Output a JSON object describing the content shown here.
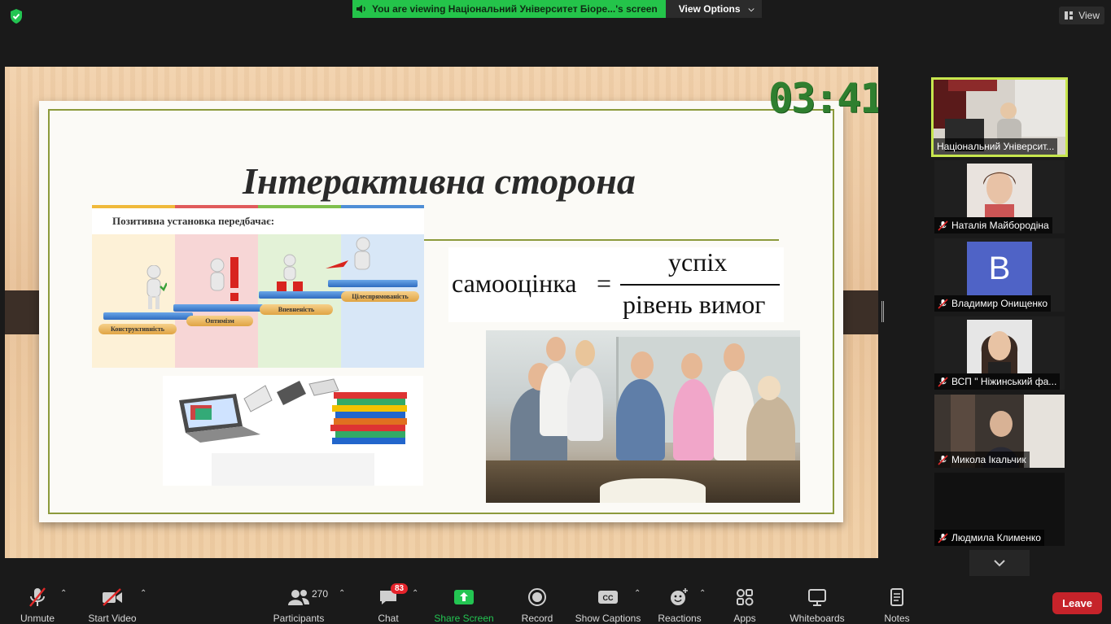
{
  "top": {
    "viewing_text": "You are viewing Національний Університет Біоре...'s screen",
    "view_options": "View Options",
    "view": "View"
  },
  "shared": {
    "timer": "03:41",
    "slide_title": "Інтерактивна сторона",
    "positive": {
      "heading": "Позитивна установка передбачає:",
      "steps": [
        "Конструктивність",
        "Оптимізм",
        "Впевненість",
        "Цілеспрямованість"
      ]
    },
    "formula": {
      "left": "самооцінка",
      "eq": "=",
      "numerator": "успіх",
      "denominator": "рівень вимог"
    }
  },
  "participants_panel": [
    {
      "name": "Національний Університ...",
      "active": true
    },
    {
      "name": "Наталія Майбородіна",
      "muted": true
    },
    {
      "name": "Владимир Онищенко",
      "muted": true,
      "avatar_letter": "B"
    },
    {
      "name": "ВСП \" Ніжинський фа...",
      "muted": true
    },
    {
      "name": "Микола Ікальчик",
      "muted": true
    },
    {
      "name": "Людмила Клименко",
      "muted": true
    }
  ],
  "toolbar": {
    "unmute": "Unmute",
    "start_video": "Start Video",
    "participants": "Participants",
    "participants_count": "270",
    "chat": "Chat",
    "chat_badge": "83",
    "share_screen": "Share Screen",
    "record": "Record",
    "show_captions": "Show Captions",
    "reactions": "Reactions",
    "apps": "Apps",
    "whiteboards": "Whiteboards",
    "notes": "Notes",
    "leave": "Leave"
  },
  "colors": {
    "banner_green": "#24c44a",
    "active_border": "#c7e64e",
    "leave_red": "#c6232a",
    "share_green": "#23c552",
    "slide_border": "#8c9a3c",
    "timer_green": "#2f7f2f"
  }
}
